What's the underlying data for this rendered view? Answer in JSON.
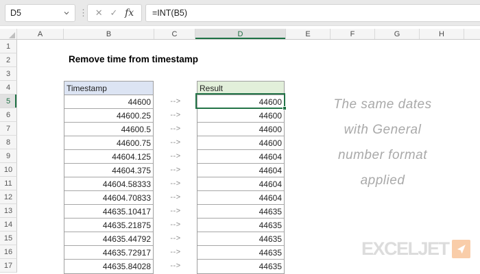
{
  "formula_bar": {
    "name_box": "D5",
    "formula": "=INT(B5)"
  },
  "icons": {
    "dots": "⋮",
    "cancel": "✕",
    "confirm": "✓",
    "fx": "fx"
  },
  "grid": {
    "column_headers": [
      "A",
      "B",
      "C",
      "D",
      "E",
      "F",
      "G",
      "H"
    ],
    "selected_column": "D",
    "row_headers": [
      1,
      2,
      3,
      4,
      5,
      6,
      7,
      8,
      9,
      10,
      11,
      12,
      13,
      14,
      15,
      16,
      17
    ],
    "selected_row": 5,
    "selected_cell": "D5"
  },
  "sheet": {
    "title": "Remove time from timestamp",
    "timestamp_header": "Timestamp",
    "result_header": "Result",
    "arrow": "-->",
    "first_data_row": 5,
    "rows": [
      {
        "timestamp": "44600",
        "result": "44600"
      },
      {
        "timestamp": "44600.25",
        "result": "44600"
      },
      {
        "timestamp": "44600.5",
        "result": "44600"
      },
      {
        "timestamp": "44600.75",
        "result": "44600"
      },
      {
        "timestamp": "44604.125",
        "result": "44604"
      },
      {
        "timestamp": "44604.375",
        "result": "44604"
      },
      {
        "timestamp": "44604.58333",
        "result": "44604"
      },
      {
        "timestamp": "44604.70833",
        "result": "44604"
      },
      {
        "timestamp": "44635.10417",
        "result": "44635"
      },
      {
        "timestamp": "44635.21875",
        "result": "44635"
      },
      {
        "timestamp": "44635.44792",
        "result": "44635"
      },
      {
        "timestamp": "44635.72917",
        "result": "44635"
      },
      {
        "timestamp": "44635.84028",
        "result": "44635"
      }
    ],
    "annotation_lines": [
      "The same dates",
      "with General",
      "number format",
      "applied"
    ],
    "logo_text": "EXCELJET"
  },
  "colors": {
    "excel_green": "#217346",
    "timestamp_header_bg": "#DCE4F3",
    "result_header_bg": "#E2EFDA",
    "annotation_gray": "#A9A9A9",
    "logo_gray": "#DCDCDC",
    "logo_orange": "#F9CDA9"
  }
}
